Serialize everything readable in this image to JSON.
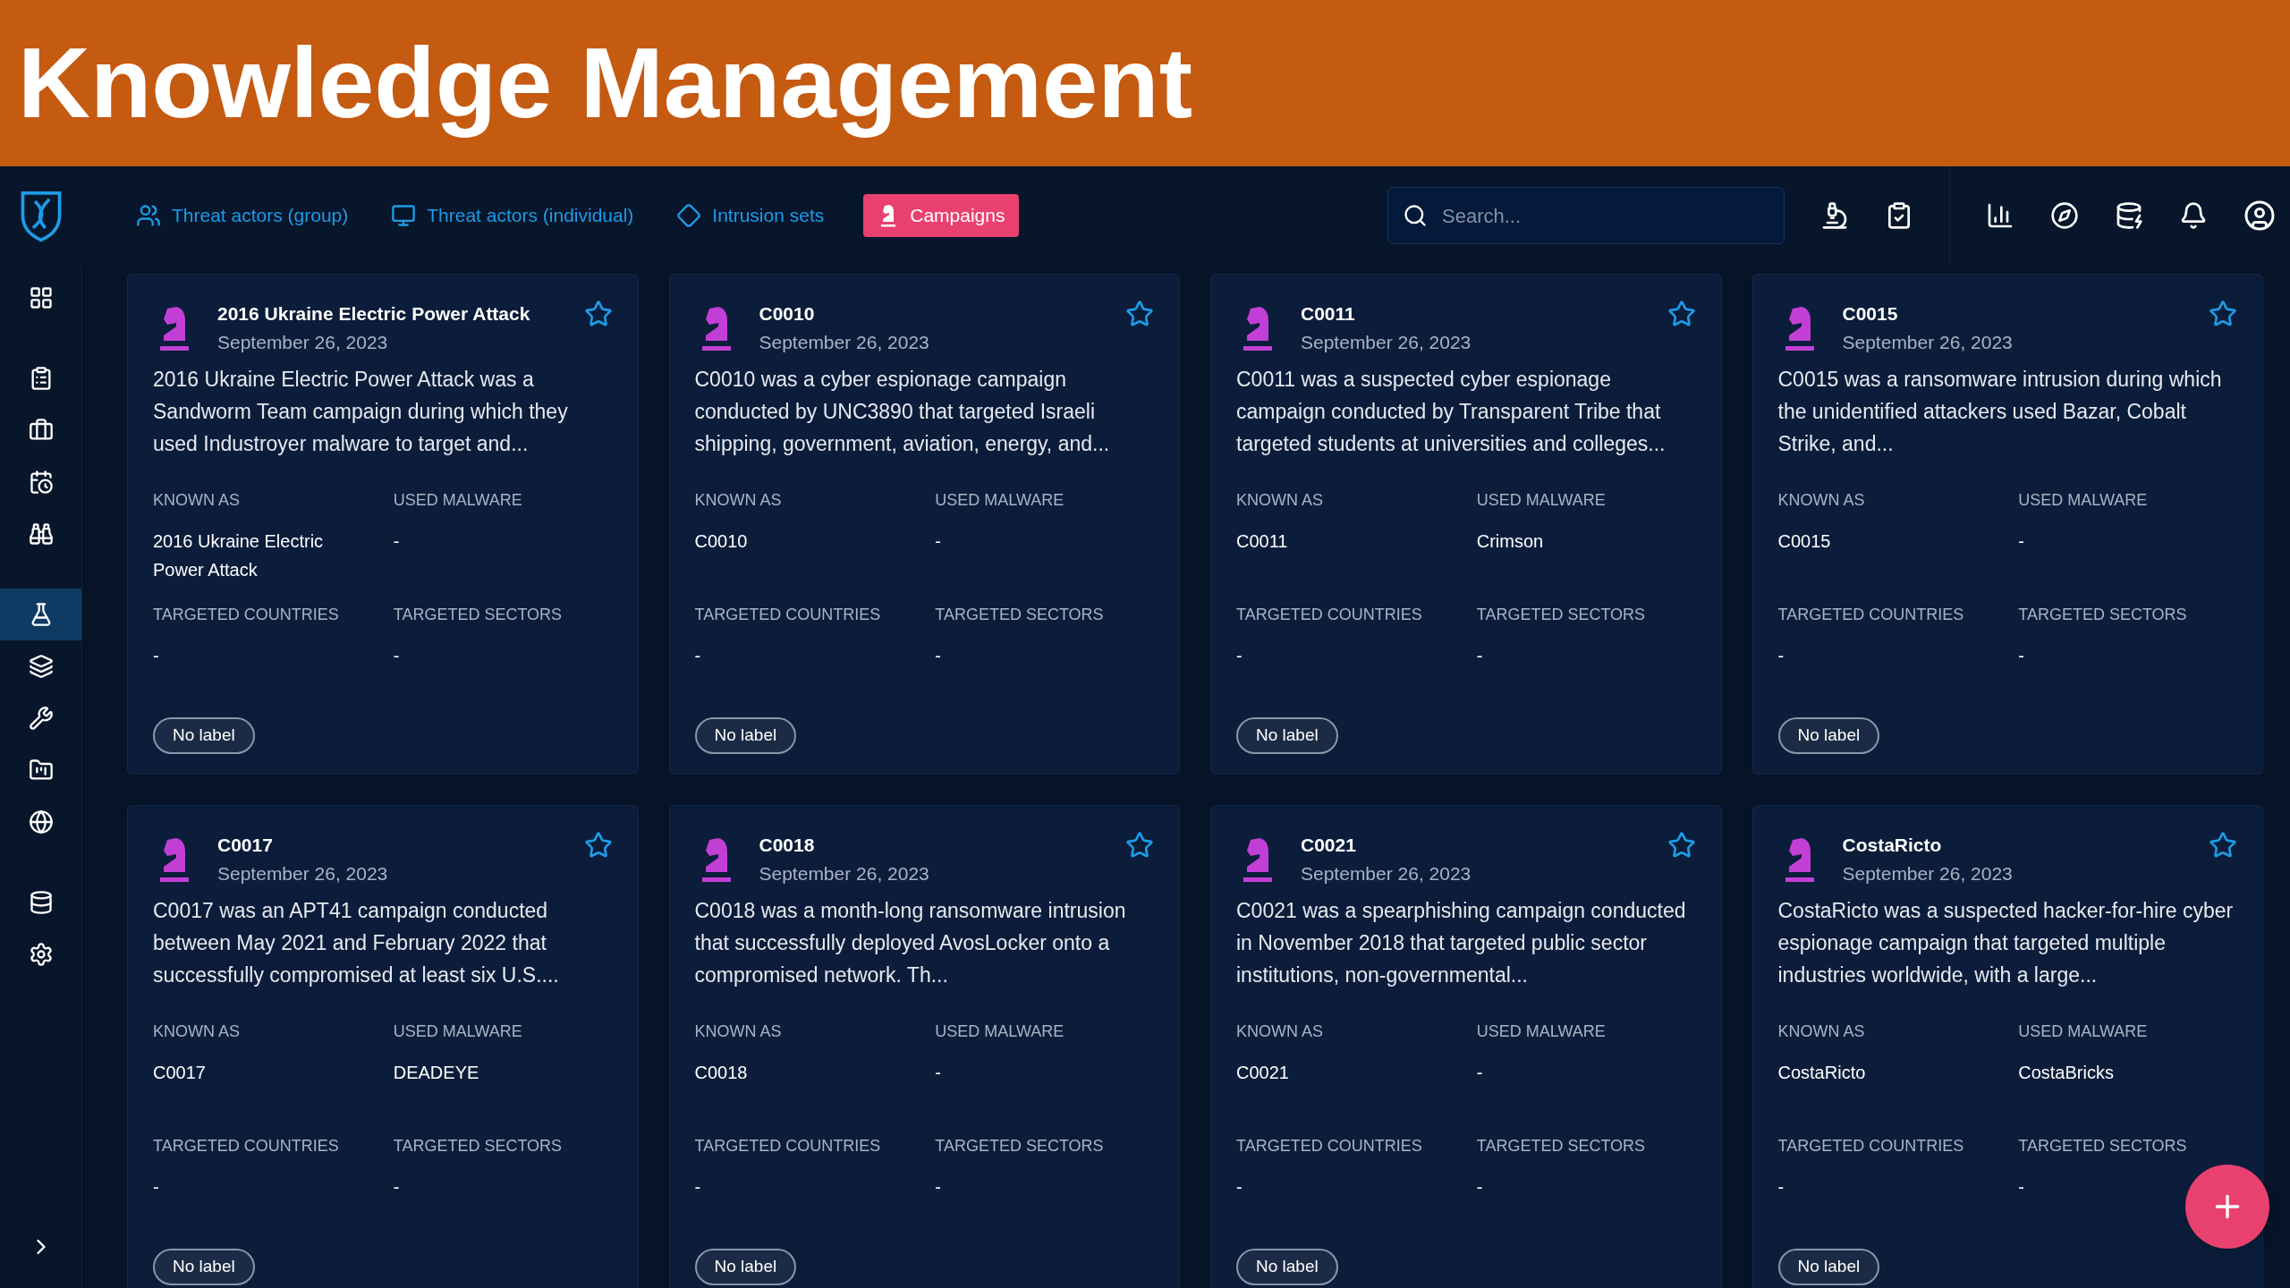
{
  "banner": {
    "title": "Knowledge Management"
  },
  "nav_tabs": [
    {
      "label": "Threat actors (group)",
      "kind": "group",
      "selected": false
    },
    {
      "label": "Threat actors (individual)",
      "kind": "individual",
      "selected": false
    },
    {
      "label": "Intrusion sets",
      "kind": "intrusion",
      "selected": false
    },
    {
      "label": "Campaigns",
      "kind": "campaign",
      "selected": true
    }
  ],
  "search": {
    "placeholder": "Search..."
  },
  "sidebar": {
    "items": [
      {
        "kind": "dashboard",
        "selected": false
      },
      {
        "kind": "analyses",
        "selected": false
      },
      {
        "kind": "cases",
        "selected": false
      },
      {
        "kind": "events",
        "selected": false
      },
      {
        "kind": "observations",
        "selected": false
      },
      {
        "kind": "threats",
        "selected": true
      },
      {
        "kind": "arsenal",
        "selected": false
      },
      {
        "kind": "techniques",
        "selected": false
      },
      {
        "kind": "entities",
        "selected": false
      },
      {
        "kind": "locations",
        "selected": false
      },
      {
        "kind": "data",
        "selected": false
      },
      {
        "kind": "settings",
        "selected": false
      }
    ]
  },
  "cards": [
    {
      "title": "2016 Ukraine Electric Power Attack",
      "date": "September 26, 2023",
      "description": "2016 Ukraine Electric Power Attack was a Sandworm Team campaign during which they used Industroyer malware to target and...",
      "fields": [
        {
          "label": "KNOWN AS",
          "value": "2016 Ukraine Electric Power Attack"
        },
        {
          "label": "USED MALWARE",
          "value": "-"
        },
        {
          "label": "TARGETED COUNTRIES",
          "value": "-"
        },
        {
          "label": "TARGETED SECTORS",
          "value": "-"
        }
      ],
      "chip": "No label"
    },
    {
      "title": "C0010",
      "date": "September 26, 2023",
      "description": "C0010 was a cyber espionage campaign conducted by UNC3890 that targeted Israeli shipping, government, aviation, energy, and...",
      "fields": [
        {
          "label": "KNOWN AS",
          "value": "C0010"
        },
        {
          "label": "USED MALWARE",
          "value": "-"
        },
        {
          "label": "TARGETED COUNTRIES",
          "value": "-"
        },
        {
          "label": "TARGETED SECTORS",
          "value": "-"
        }
      ],
      "chip": "No label"
    },
    {
      "title": "C0011",
      "date": "September 26, 2023",
      "description": "C0011 was a suspected cyber espionage campaign conducted by Transparent Tribe that targeted students at universities and colleges...",
      "fields": [
        {
          "label": "KNOWN AS",
          "value": "C0011"
        },
        {
          "label": "USED MALWARE",
          "value": "Crimson"
        },
        {
          "label": "TARGETED COUNTRIES",
          "value": "-"
        },
        {
          "label": "TARGETED SECTORS",
          "value": "-"
        }
      ],
      "chip": "No label"
    },
    {
      "title": "C0015",
      "date": "September 26, 2023",
      "description": "C0015 was a ransomware intrusion during which the unidentified attackers used Bazar, Cobalt Strike, and...",
      "fields": [
        {
          "label": "KNOWN AS",
          "value": "C0015"
        },
        {
          "label": "USED MALWARE",
          "value": "-"
        },
        {
          "label": "TARGETED COUNTRIES",
          "value": "-"
        },
        {
          "label": "TARGETED SECTORS",
          "value": "-"
        }
      ],
      "chip": "No label"
    },
    {
      "title": "C0017",
      "date": "September 26, 2023",
      "description": "C0017 was an APT41 campaign conducted between May 2021 and February 2022 that successfully compromised at least six U.S....",
      "fields": [
        {
          "label": "KNOWN AS",
          "value": "C0017"
        },
        {
          "label": "USED MALWARE",
          "value": "DEADEYE"
        },
        {
          "label": "TARGETED COUNTRIES",
          "value": "-"
        },
        {
          "label": "TARGETED SECTORS",
          "value": "-"
        }
      ],
      "chip": "No label"
    },
    {
      "title": "C0018",
      "date": "September 26, 2023",
      "description": "C0018 was a month-long ransomware intrusion that successfully deployed AvosLocker onto a compromised network. Th...",
      "fields": [
        {
          "label": "KNOWN AS",
          "value": "C0018"
        },
        {
          "label": "USED MALWARE",
          "value": "-"
        },
        {
          "label": "TARGETED COUNTRIES",
          "value": "-"
        },
        {
          "label": "TARGETED SECTORS",
          "value": "-"
        }
      ],
      "chip": "No label"
    },
    {
      "title": "C0021",
      "date": "September 26, 2023",
      "description": "C0021 was a spearphishing campaign conducted in November 2018 that targeted public sector institutions, non-governmental...",
      "fields": [
        {
          "label": "KNOWN AS",
          "value": "C0021"
        },
        {
          "label": "USED MALWARE",
          "value": "-"
        },
        {
          "label": "TARGETED COUNTRIES",
          "value": "-"
        },
        {
          "label": "TARGETED SECTORS",
          "value": "-"
        }
      ],
      "chip": "No label"
    },
    {
      "title": "CostaRicto",
      "date": "September 26, 2023",
      "description": "CostaRicto was a suspected hacker-for-hire cyber espionage campaign that targeted multiple industries worldwide, with a large...",
      "fields": [
        {
          "label": "KNOWN AS",
          "value": "CostaRicto"
        },
        {
          "label": "USED MALWARE",
          "value": "CostaBricks"
        },
        {
          "label": "TARGETED COUNTRIES",
          "value": "-"
        },
        {
          "label": "TARGETED SECTORS",
          "value": "-"
        }
      ],
      "chip": "No label"
    }
  ]
}
